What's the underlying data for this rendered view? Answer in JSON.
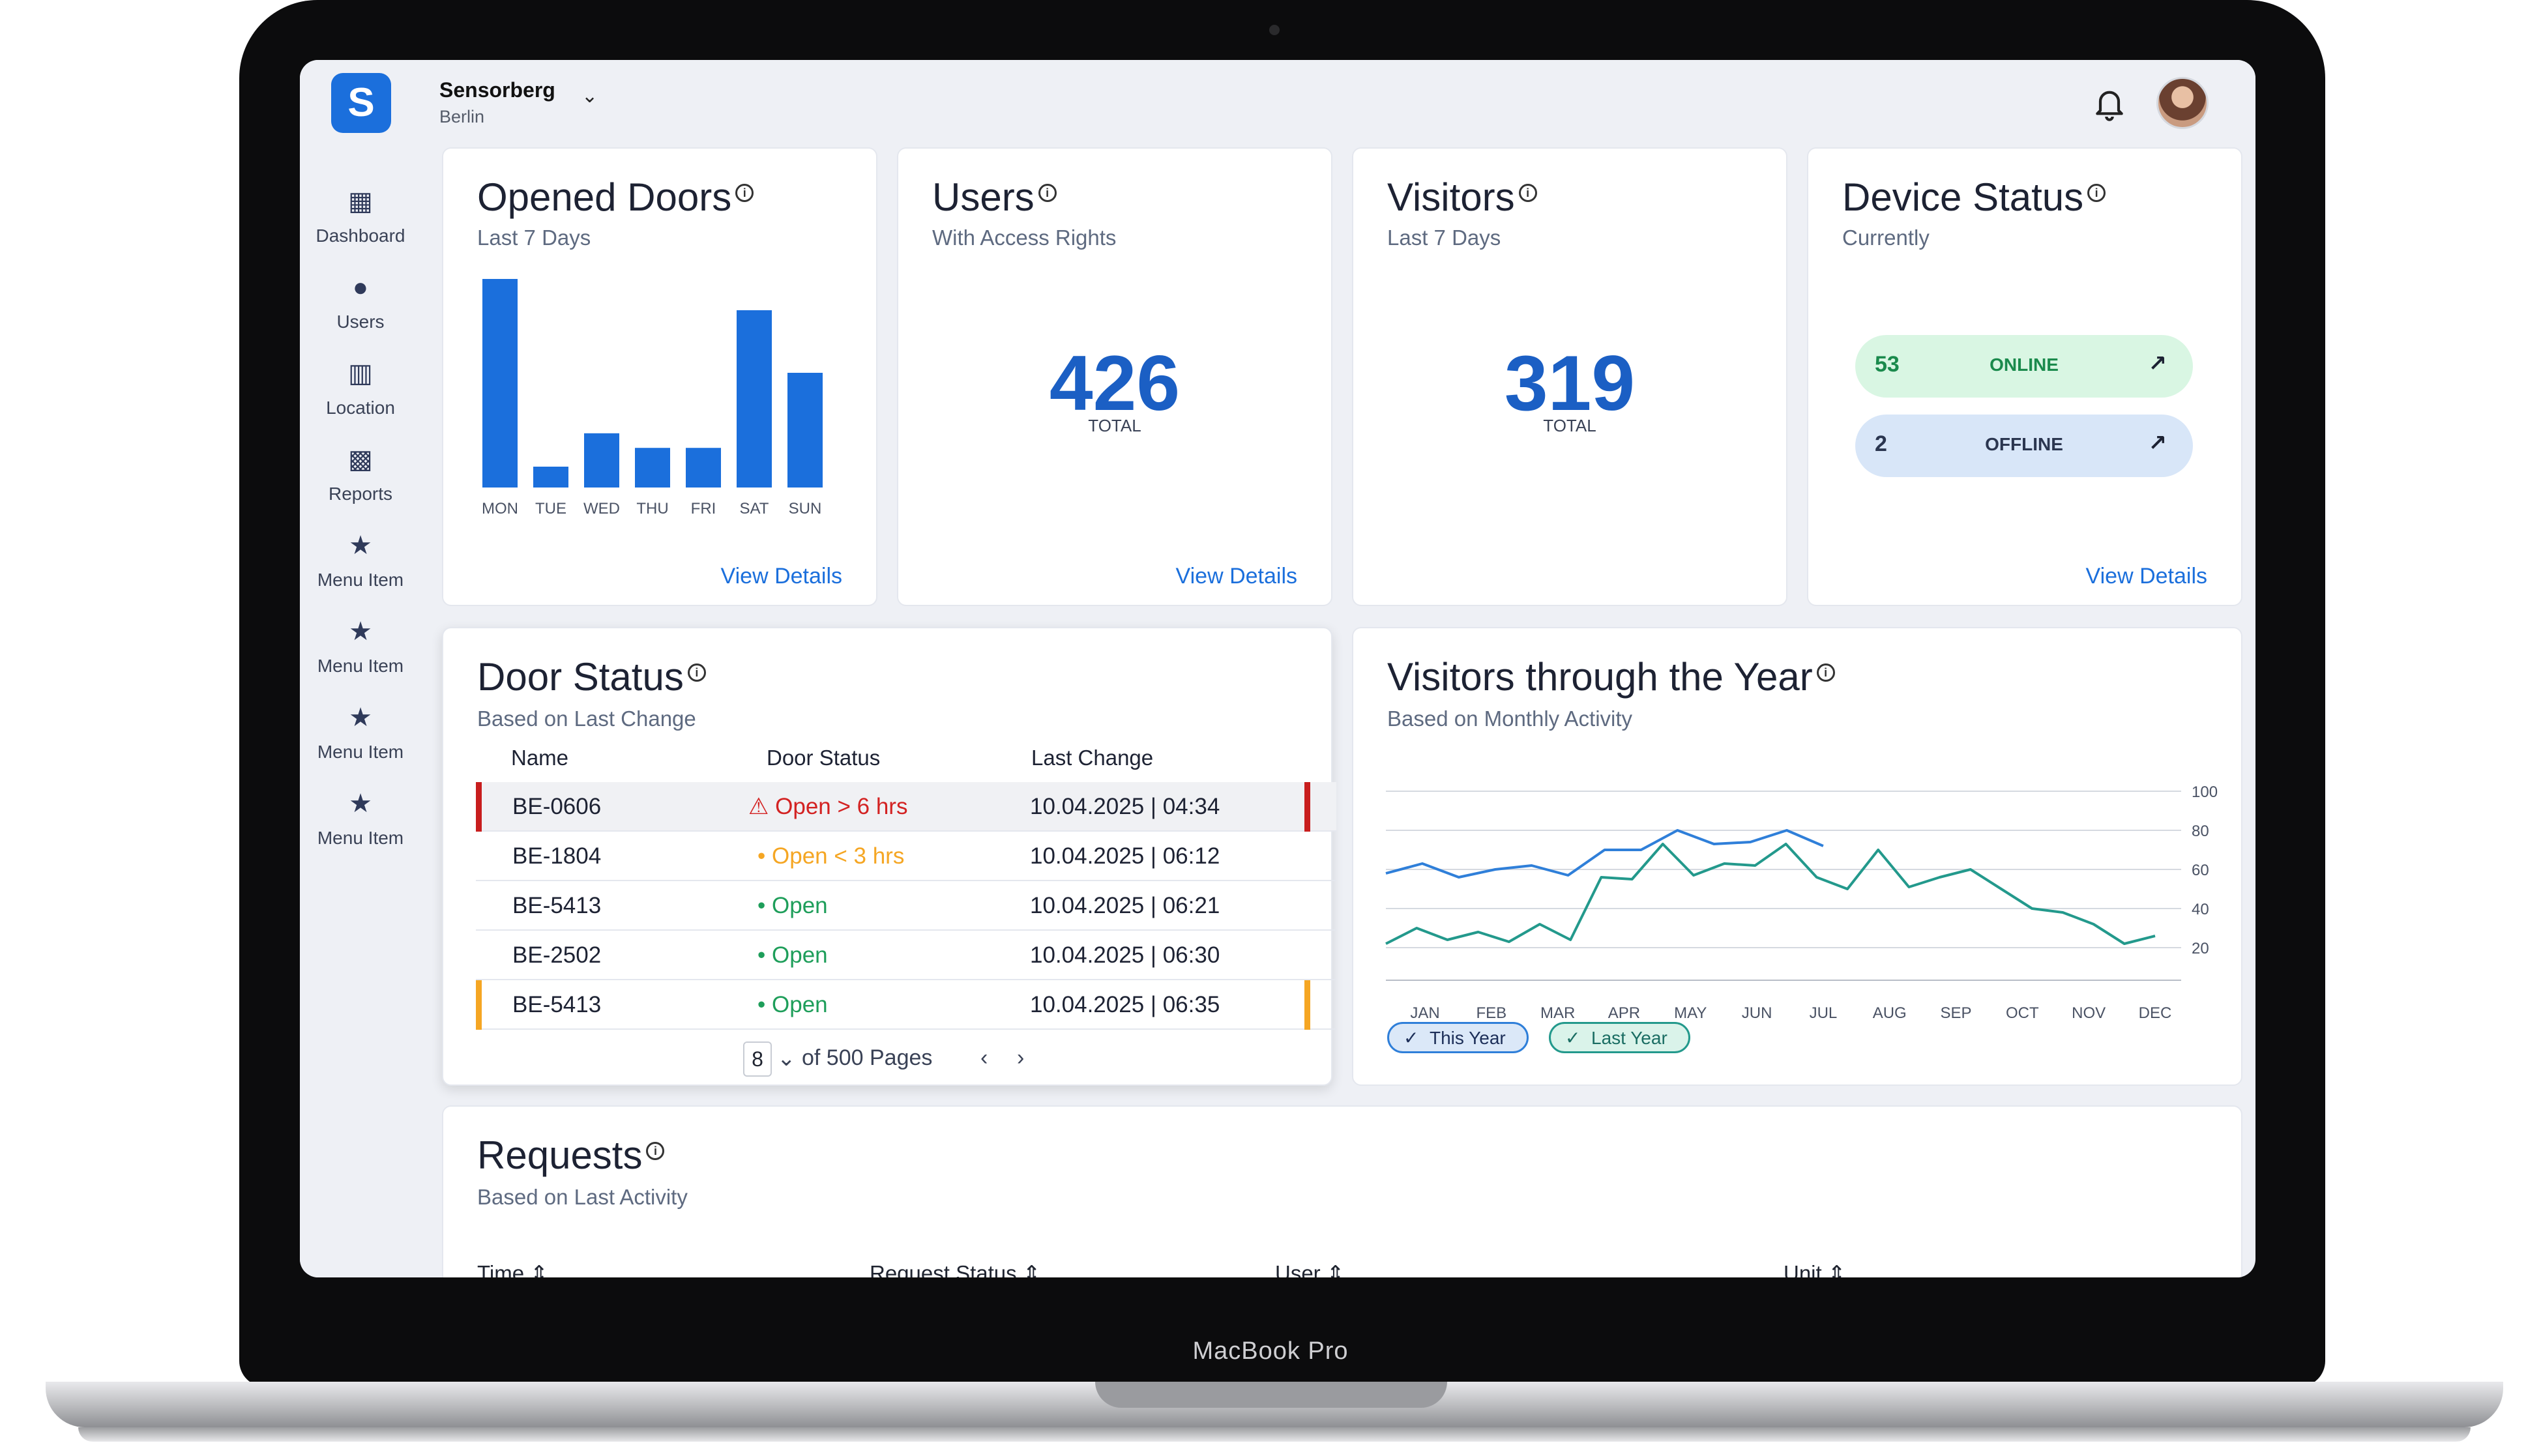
{
  "device_label": "MacBook Pro",
  "header": {
    "org_name": "Sensorberg",
    "org_city": "Berlin"
  },
  "sidebar": {
    "items": [
      {
        "label": "Dashboard",
        "icon": "dashboard-icon"
      },
      {
        "label": "Users",
        "icon": "user-icon"
      },
      {
        "label": "Location",
        "icon": "building-icon"
      },
      {
        "label": "Reports",
        "icon": "report-icon"
      },
      {
        "label": "Menu Item",
        "icon": "star-icon"
      },
      {
        "label": "Menu Item",
        "icon": "star-icon"
      },
      {
        "label": "Menu Item",
        "icon": "star-icon"
      },
      {
        "label": "Menu Item",
        "icon": "star-icon"
      }
    ]
  },
  "opened_doors": {
    "title": "Opened Doors",
    "subtitle": "Last 7 Days",
    "link": "View Details"
  },
  "users_card": {
    "title": "Users",
    "subtitle": "With Access Rights",
    "value": "426",
    "value_label": "TOTAL",
    "link": "View Details"
  },
  "visitors_card": {
    "title": "Visitors",
    "subtitle": "Last 7 Days",
    "value": "319",
    "value_label": "TOTAL"
  },
  "device_status": {
    "title": "Device Status",
    "subtitle": "Currently",
    "link": "View Details",
    "online_count": "53",
    "online_label": "ONLINE",
    "offline_count": "2",
    "offline_label": "OFFLINE"
  },
  "door_status": {
    "title": "Door Status",
    "subtitle": "Based on Last Change",
    "columns": [
      "Name",
      "Door Status",
      "Last Change"
    ],
    "rows": [
      {
        "name": "BE-0606",
        "status": "Open > 6 hrs",
        "change": "10.04.2025 | 04:34"
      },
      {
        "name": "BE-1804",
        "status": "Open < 3 hrs",
        "change": "10.04.2025 | 06:12"
      },
      {
        "name": "BE-5413",
        "status": "Open",
        "change": "10.04.2025 | 06:21"
      },
      {
        "name": "BE-2502",
        "status": "Open",
        "change": "10.04.2025 | 06:30"
      },
      {
        "name": "BE-5413",
        "status": "Open",
        "change": "10.04.2025 | 06:35"
      }
    ],
    "page": "8",
    "page_suffix": "of 500 Pages",
    "colors": {
      "alert": "#d32222",
      "warning": "#f5a623",
      "ok": "#1e9e5a"
    }
  },
  "visitors_year": {
    "title": "Visitors through the Year",
    "subtitle": "Based on Monthly Activity",
    "legend_this": "This Year",
    "legend_last": "Last Year"
  },
  "requests": {
    "title": "Requests",
    "subtitle": "Based on Last Activity",
    "columns": [
      "Time",
      "Request Status",
      "User",
      "Unit"
    ]
  },
  "chart_data": [
    {
      "type": "bar",
      "categories": [
        "MON",
        "TUE",
        "WED",
        "THU",
        "FRI",
        "SAT",
        "SUN"
      ],
      "values": [
        100,
        10,
        26,
        19,
        19,
        85,
        55
      ],
      "ylim": [
        0,
        100
      ],
      "color": "#1b6fdc"
    },
    {
      "type": "line",
      "x": [
        "JAN",
        "FEB",
        "MAR",
        "APR",
        "MAY",
        "JUN",
        "JUL",
        "AUG",
        "SEP",
        "OCT",
        "NOV",
        "DEC"
      ],
      "yticks": [
        20,
        40,
        60,
        80,
        100
      ],
      "ylim": [
        10,
        100
      ],
      "grid": true,
      "series": [
        {
          "name": "This Year",
          "color": "#2f7fd9",
          "values": [
            58,
            63,
            56,
            60,
            62,
            57,
            70,
            70,
            80,
            73,
            74,
            80,
            72
          ]
        },
        {
          "name": "Last Year",
          "color": "#23998c",
          "values": [
            22,
            30,
            24,
            28,
            23,
            32,
            24,
            56,
            55,
            73,
            57,
            63,
            62,
            73,
            56,
            50,
            70,
            51,
            56,
            60,
            50,
            40,
            38,
            32,
            22,
            26
          ]
        }
      ]
    }
  ]
}
